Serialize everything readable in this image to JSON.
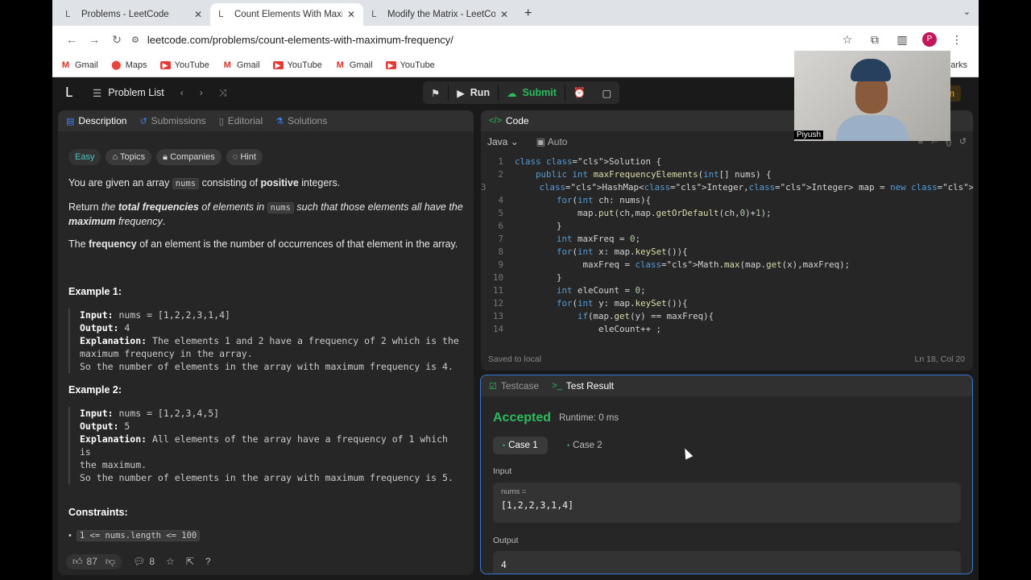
{
  "browser": {
    "tabs": [
      {
        "title": "Problems - LeetCode",
        "active": false
      },
      {
        "title": "Count Elements With Maximum",
        "active": true
      },
      {
        "title": "Modify the Matrix - LeetCode",
        "active": false
      }
    ],
    "url": "leetcode.com/problems/count-elements-with-maximum-frequency/",
    "avatar_letter": "P",
    "bookmarks": [
      "Gmail",
      "Maps",
      "YouTube",
      "Gmail",
      "YouTube",
      "Gmail",
      "YouTube"
    ],
    "bookmarks_right": "marks"
  },
  "nav": {
    "problem_list": "Problem List",
    "run": "Run",
    "submit": "Submit",
    "premium": "um"
  },
  "left": {
    "tabs": [
      "Description",
      "Submissions",
      "Editorial",
      "Solutions"
    ],
    "tags": [
      "Easy",
      "Topics",
      "Companies",
      "Hint"
    ],
    "p1_pre": "You are given an array ",
    "p1_code": "nums",
    "p1_mid": " consisting of ",
    "p1_bold": "positive",
    "p1_post": " integers.",
    "p2_a": "Return ",
    "p2_b": "the ",
    "p2_c": "total frequencies",
    "p2_d": " of elements in ",
    "p2_code": "nums",
    "p2_e": " such that those elements all have the",
    "p2_f": "maximum",
    "p2_g": " frequency",
    "p2_h": ".",
    "p3_a": "The ",
    "p3_b": "frequency",
    "p3_c": " of an element is the number of occurrences of that element in the array.",
    "ex1_title": "Example 1:",
    "ex1_lines": [
      {
        "k": "Input:",
        "v": " nums = [1,2,2,3,1,4]"
      },
      {
        "k": "Output:",
        "v": " 4"
      },
      {
        "k": "Explanation:",
        "v": " The elements 1 and 2 have a frequency of 2 which is the"
      },
      {
        "k": "",
        "v": "maximum frequency in the array."
      },
      {
        "k": "",
        "v": "So the number of elements in the array with maximum frequency is 4."
      }
    ],
    "ex2_title": "Example 2:",
    "ex2_lines": [
      {
        "k": "Input:",
        "v": " nums = [1,2,3,4,5]"
      },
      {
        "k": "Output:",
        "v": " 5"
      },
      {
        "k": "Explanation:",
        "v": " All elements of the array have a frequency of 1 which is"
      },
      {
        "k": "",
        "v": "the maximum."
      },
      {
        "k": "",
        "v": "So the number of elements in the array with maximum frequency is 5."
      }
    ],
    "constraints_title": "Constraints:",
    "constraint1": "1 <= nums.length <= 100",
    "likes": "87",
    "comments": "8"
  },
  "code": {
    "title": "Code",
    "language": "Java",
    "mode": "Auto",
    "lines": [
      "class Solution {",
      "    public int maxFrequencyElements(int[] nums) {",
      "        HashMap<Integer,Integer> map = new HashMap<>();",
      "        for(int ch: nums){",
      "            map.put(ch,map.getOrDefault(ch,0)+1);",
      "        }",
      "        int maxFreq = 0;",
      "        for(int x: map.keySet()){",
      "             maxFreq = Math.max(map.get(x),maxFreq);",
      "        }",
      "        int eleCount = 0;",
      "        for(int y: map.keySet()){",
      "            if(map.get(y) == maxFreq){",
      "                eleCount++ ;"
    ],
    "saved": "Saved to local",
    "cursor": "Ln 18, Col 20"
  },
  "result": {
    "tabs": [
      "Testcase",
      "Test Result"
    ],
    "status": "Accepted",
    "runtime": "Runtime: 0 ms",
    "cases": [
      "Case 1",
      "Case 2"
    ],
    "input_label": "Input",
    "input_key": "nums =",
    "input_value": "[1,2,2,3,1,4]",
    "output_label": "Output",
    "output_value": "4"
  },
  "webcam": {
    "name": "Piyush"
  }
}
